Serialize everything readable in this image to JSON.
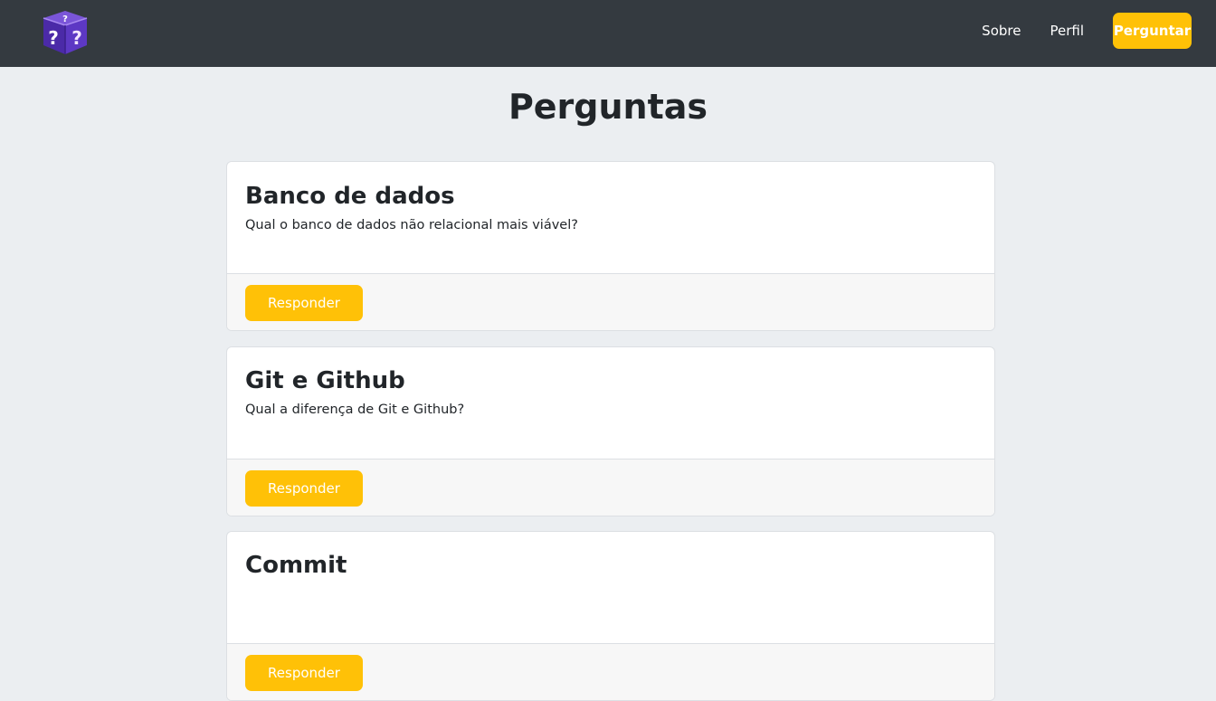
{
  "navbar": {
    "logo_icon": "question-box-logo-icon",
    "links": [
      "Sobre",
      "Perfil"
    ],
    "ask_button": "Perguntar"
  },
  "page": {
    "title": "Perguntas"
  },
  "questions": [
    {
      "title": "Banco de dados",
      "text": "Qual o banco de dados não relacional mais viável?",
      "button": "Responder"
    },
    {
      "title": "Git e Github",
      "text": "Qual a diferença de Git e Github?",
      "button": "Responder"
    },
    {
      "title": "Commit",
      "text": "",
      "button": "Responder"
    }
  ],
  "colors": {
    "navbar": "#343a40",
    "accent": "#ffc107",
    "background": "#ebeef1"
  }
}
